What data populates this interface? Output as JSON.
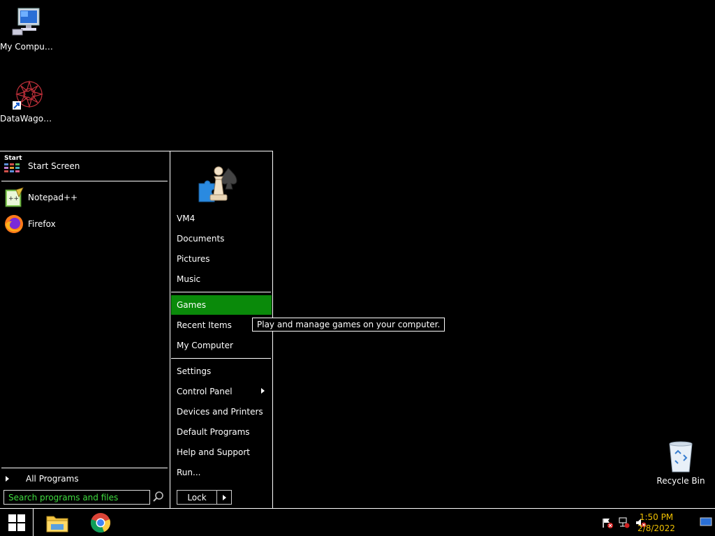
{
  "desktop": {
    "icons": [
      {
        "label": "My Computer"
      },
      {
        "label": "DataWagon..."
      },
      {
        "label": "Recycle Bin"
      }
    ]
  },
  "start_menu": {
    "left": {
      "pinned": [
        {
          "label": "Start Screen",
          "badge": "Start",
          "icon": "start-screen-icon"
        },
        {
          "label": "Notepad++",
          "icon": "notepadpp-icon"
        },
        {
          "label": "Firefox",
          "icon": "firefox-icon"
        }
      ],
      "all_programs": "All Programs",
      "search_placeholder": "Search programs and files"
    },
    "right": {
      "user_icon": "games-chess-puzzle-icon",
      "items": [
        {
          "label": "VM4"
        },
        {
          "label": "Documents"
        },
        {
          "label": "Pictures"
        },
        {
          "label": "Music"
        },
        {
          "label": "Games"
        },
        {
          "label": "Recent Items"
        },
        {
          "label": "My Computer"
        },
        {
          "label": "Settings"
        },
        {
          "label": "Control Panel"
        },
        {
          "label": "Devices and Printers"
        },
        {
          "label": "Default Programs"
        },
        {
          "label": "Help and Support"
        },
        {
          "label": "Run..."
        }
      ],
      "lock_label": "Lock"
    },
    "tooltip": "Play and manage games on your computer."
  },
  "taskbar": {
    "time": "1:50 PM",
    "date": "2/8/2022"
  },
  "colors": {
    "highlight": "#0a8a0a",
    "search_text": "#3fdc3f",
    "clock_text": "#f0c000"
  }
}
